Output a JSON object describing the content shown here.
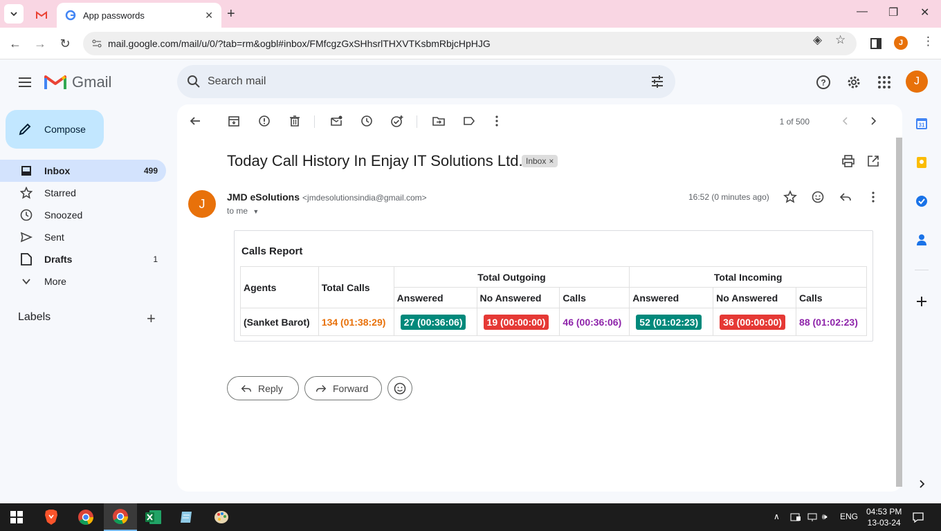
{
  "browser": {
    "tab_title": "App passwords",
    "url": "mail.google.com/mail/u/0/?tab=rm&ogbl#inbox/FMfcgzGxSHhsrlTHXVTKsbmRbjcHpHJG",
    "profile_initial": "J"
  },
  "gmail": {
    "logo_text": "Gmail",
    "search_placeholder": "Search mail",
    "avatar_initial": "J"
  },
  "sidebar": {
    "compose_label": "Compose",
    "items": [
      {
        "label": "Inbox",
        "count": "499"
      },
      {
        "label": "Starred",
        "count": ""
      },
      {
        "label": "Snoozed",
        "count": ""
      },
      {
        "label": "Sent",
        "count": ""
      },
      {
        "label": "Drafts",
        "count": "1"
      },
      {
        "label": "More",
        "count": ""
      }
    ],
    "labels_heading": "Labels"
  },
  "message": {
    "pager": "1 of 500",
    "subject": "Today Call History In Enjay IT Solutions Ltd.",
    "chip_label": "Inbox",
    "sender_initial": "J",
    "sender_name": "JMD eSolutions",
    "sender_email": "<jmdesolutionsindia@gmail.com>",
    "to_line": "to me",
    "time": "16:52 (0 minutes ago)",
    "report": {
      "title": "Calls Report",
      "headers": {
        "agents": "Agents",
        "total_calls": "Total Calls",
        "total_outgoing": "Total Outgoing",
        "total_incoming": "Total Incoming",
        "answered": "Answered",
        "no_answered": "No Answered",
        "calls": "Calls"
      },
      "row": {
        "agent": "(Sanket Barot)",
        "total_calls": "134 (01:38:29)",
        "out_answered": "27 (00:36:06)",
        "out_no_answered": "19 (00:00:00)",
        "out_calls": "46 (00:36:06)",
        "in_answered": "52 (01:02:23)",
        "in_no_answered": "36 (00:00:00)",
        "in_calls": "88 (01:02:23)"
      }
    },
    "reply_label": "Reply",
    "forward_label": "Forward"
  },
  "taskbar": {
    "lang": "ENG",
    "time": "04:53 PM",
    "date": "13-03-24"
  },
  "colors": {
    "tabstrip": "#f9d6e3",
    "accent_orange": "#e8710a",
    "teal": "#00897b",
    "red": "#e53935",
    "purple": "#8e24aa",
    "nav_active": "#d3e3fd",
    "compose": "#c2e7ff"
  }
}
